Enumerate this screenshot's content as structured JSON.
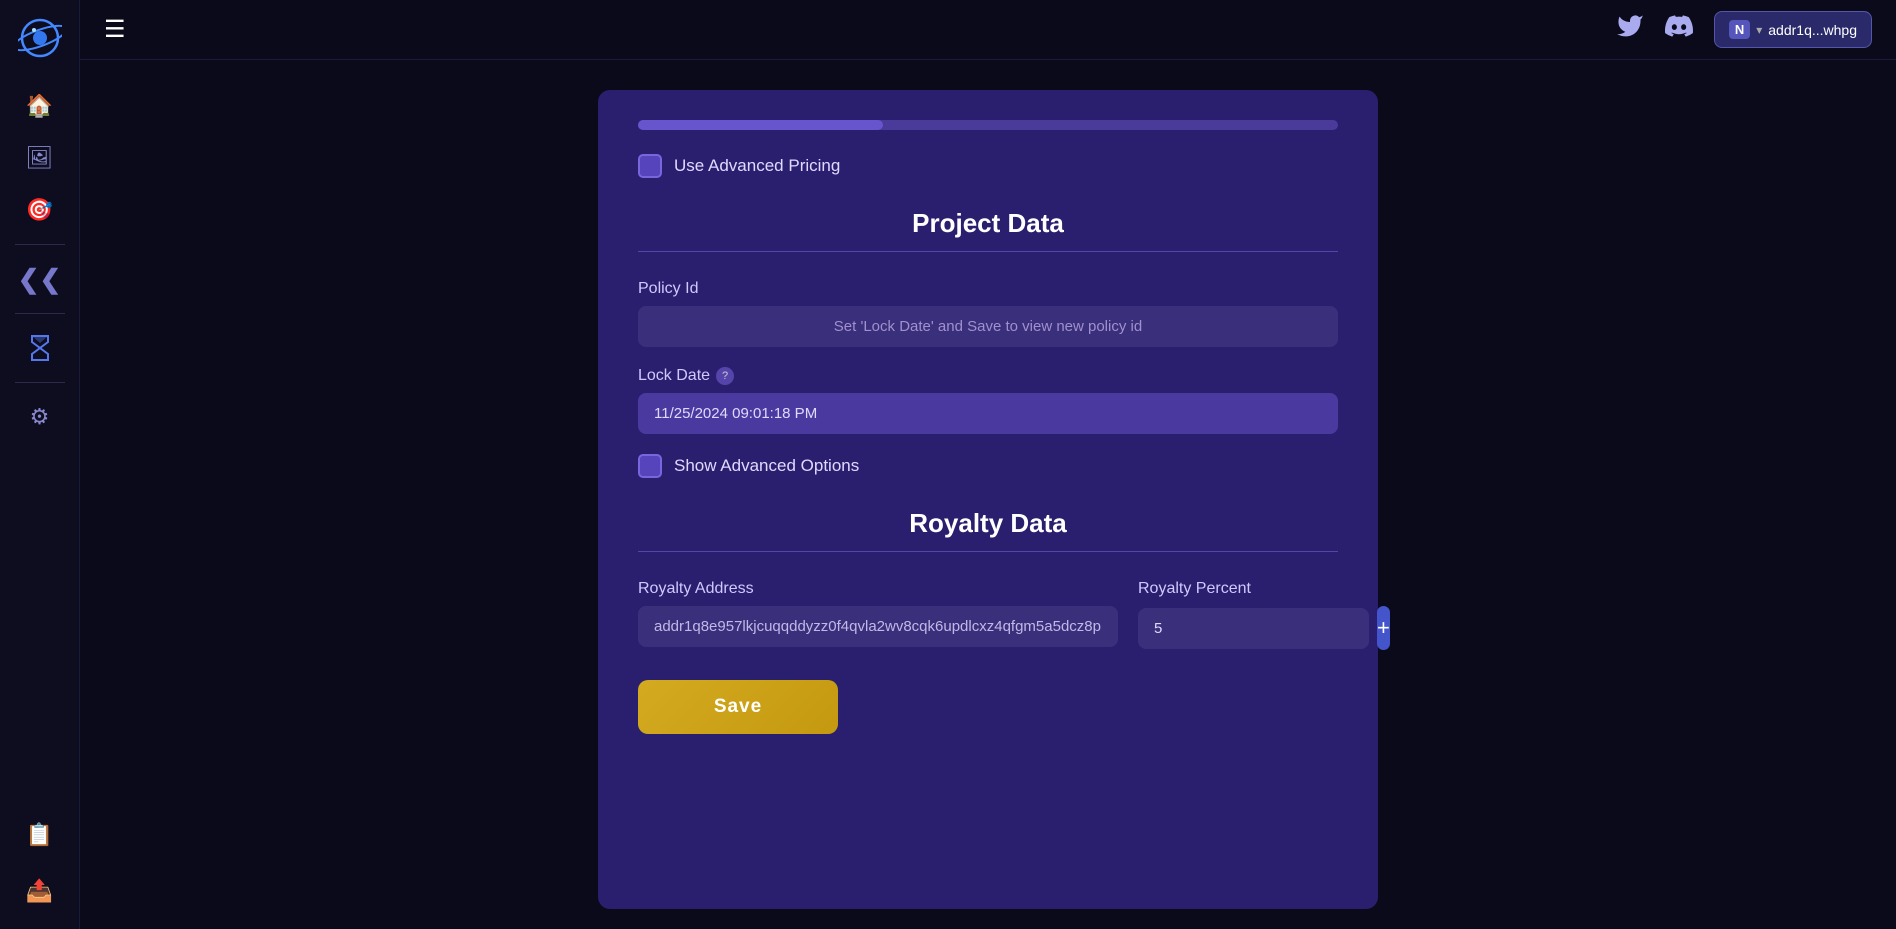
{
  "app": {
    "logo_alt": "Planet logo"
  },
  "topbar": {
    "hamburger_label": "☰",
    "twitter_icon": "twitter",
    "discord_icon": "discord",
    "wallet_n": "N",
    "wallet_address": "addr1q...whpg"
  },
  "sidebar": {
    "items": [
      {
        "icon": "🏠",
        "name": "home"
      },
      {
        "icon": "🖼",
        "name": "gallery"
      },
      {
        "icon": "🎯",
        "name": "target"
      },
      {
        "icon": "⟪",
        "name": "arrows-up"
      },
      {
        "icon": "⌛",
        "name": "hourglass"
      },
      {
        "icon": "⚙",
        "name": "settings"
      }
    ],
    "bottom_items": [
      {
        "icon": "📋",
        "name": "clipboard"
      },
      {
        "icon": "📤",
        "name": "export"
      }
    ]
  },
  "card": {
    "progress_percent": 35,
    "use_advanced_pricing": {
      "label": "Use Advanced Pricing",
      "checked": false
    },
    "project_data": {
      "title": "Project Data",
      "policy_id": {
        "label": "Policy Id",
        "placeholder": "Set 'Lock Date' and Save to view new policy id"
      },
      "lock_date": {
        "label": "Lock Date",
        "help": "?",
        "value": "11/25/2024 09:01:18 PM"
      },
      "show_advanced_options": {
        "label": "Show Advanced Options",
        "checked": false
      }
    },
    "royalty_data": {
      "title": "Royalty Data",
      "royalty_address": {
        "label": "Royalty Address",
        "value": "addr1q8e957lkjcuqqddyzz0f4qvla2wv8cqk6updlcxz4qfgm5a5dcz8p"
      },
      "royalty_percent": {
        "label": "Royalty Percent",
        "value": "5"
      },
      "plus_label": "+"
    },
    "save_label": "Save"
  }
}
